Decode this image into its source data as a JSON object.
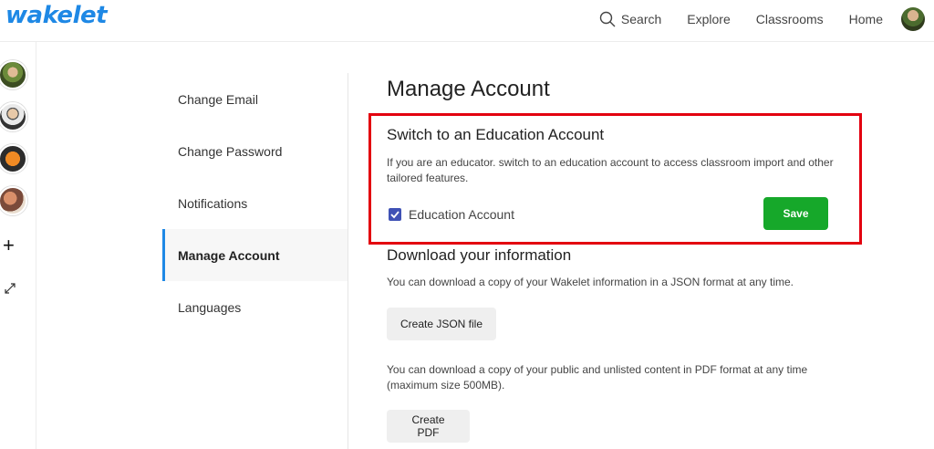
{
  "app": {
    "logo": "wakelet"
  },
  "nav": {
    "search": "Search",
    "explore": "Explore",
    "classrooms": "Classrooms",
    "home": "Home"
  },
  "rail": {
    "icons": [
      "avatar",
      "avatar",
      "avatar",
      "avatar",
      "plus-icon",
      "expand-icon"
    ],
    "plus": "+"
  },
  "menu": {
    "items": [
      {
        "label": "Change Email"
      },
      {
        "label": "Change Password"
      },
      {
        "label": "Notifications"
      },
      {
        "label": "Manage Account",
        "active": true
      },
      {
        "label": "Languages"
      }
    ]
  },
  "main": {
    "title": "Manage Account",
    "education": {
      "title": "Switch to an Education Account",
      "description": "If you are an educator. switch to an education account to access classroom import and other tailored features.",
      "checkbox_label": "Education Account",
      "checked": true,
      "save_label": "Save"
    },
    "download": {
      "title": "Download your information",
      "json_desc": "You can download a copy of your Wakelet information in a JSON format at any time.",
      "json_button": "Create JSON file",
      "pdf_desc": "You can download a copy of your public and unlisted content in PDF format at any time (maximum size 500MB).",
      "pdf_button": "Create PDF"
    }
  },
  "colors": {
    "brand": "#1e88e5",
    "highlight": "#e3000f",
    "save": "#16a82a",
    "checkbox": "#3f51b5"
  }
}
